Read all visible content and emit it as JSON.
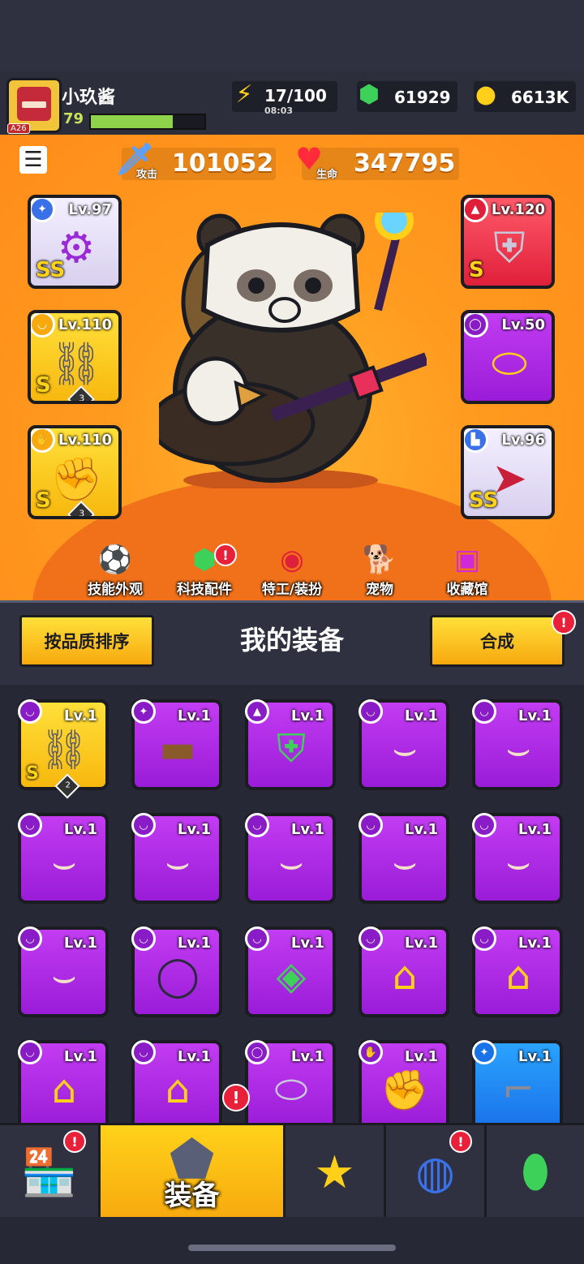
{
  "player": {
    "name": "小玖酱",
    "level": "79",
    "tag": "A26",
    "xp_fraction": 0.72
  },
  "resources": {
    "energy": {
      "value": "17/100",
      "timer": "08:03",
      "icon": "lightning-icon"
    },
    "gems": {
      "value": "61929",
      "icon": "gem-icon"
    },
    "coins": {
      "value": "6613K",
      "icon": "coin-icon"
    }
  },
  "stats": {
    "attack": {
      "label": "攻击",
      "value": "101052"
    },
    "hp": {
      "label": "生命",
      "value": "347795"
    }
  },
  "equipped": {
    "weapon": {
      "level": "Lv.97",
      "grade": "SS"
    },
    "armor": {
      "level": "Lv.120",
      "grade": "S"
    },
    "necklace": {
      "level": "Lv.110",
      "grade": "S",
      "stars": "3"
    },
    "belt": {
      "level": "Lv.50"
    },
    "gloves": {
      "level": "Lv.110",
      "grade": "S",
      "stars": "3"
    },
    "boots": {
      "level": "Lv.96",
      "grade": "SS"
    }
  },
  "tabs": [
    {
      "label": "技能外观"
    },
    {
      "label": "科技配件",
      "badge": "!"
    },
    {
      "label": "特工/装扮"
    },
    {
      "label": "宠物"
    },
    {
      "label": "收藏馆"
    }
  ],
  "inventory_header": {
    "sort": "按品质排序",
    "title": "我的装备",
    "merge": "合成",
    "badge": "!"
  },
  "inventory": [
    {
      "level": "Lv.1",
      "grade": "S",
      "stars": "2"
    },
    {
      "level": "Lv.1"
    },
    {
      "level": "Lv.1"
    },
    {
      "level": "Lv.1"
    },
    {
      "level": "Lv.1"
    },
    {
      "level": "Lv.1"
    },
    {
      "level": "Lv.1"
    },
    {
      "level": "Lv.1"
    },
    {
      "level": "Lv.1"
    },
    {
      "level": "Lv.1"
    },
    {
      "level": "Lv.1"
    },
    {
      "level": "Lv.1"
    },
    {
      "level": "Lv.1"
    },
    {
      "level": "Lv.1"
    },
    {
      "level": "Lv.1"
    },
    {
      "level": "Lv.1"
    },
    {
      "level": "Lv.1"
    },
    {
      "level": "Lv.1"
    },
    {
      "level": "Lv.1"
    },
    {
      "level": "Lv.1"
    }
  ],
  "nav": {
    "equipment": "装备",
    "badge": "!"
  }
}
